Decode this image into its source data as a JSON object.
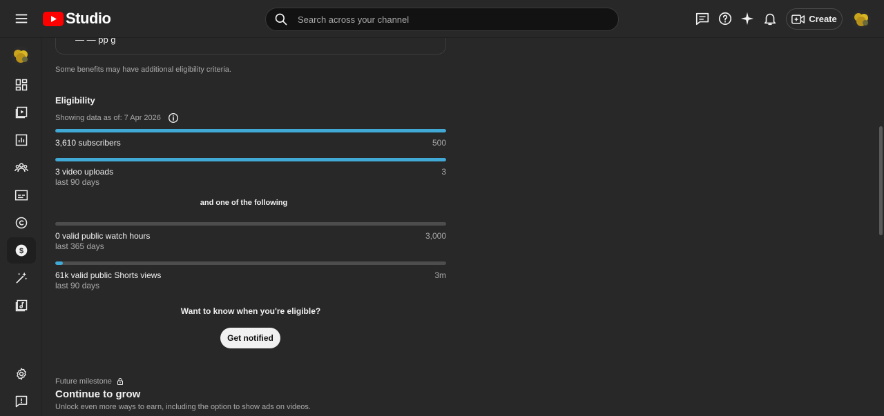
{
  "header": {
    "logo_text": "Studio",
    "search_placeholder": "Search across your channel",
    "create_label": "Create"
  },
  "sidebar": {
    "items": [
      {
        "name": "dashboard-icon"
      },
      {
        "name": "content-icon"
      },
      {
        "name": "analytics-icon"
      },
      {
        "name": "community-icon"
      },
      {
        "name": "subtitles-icon"
      },
      {
        "name": "copyright-icon"
      },
      {
        "name": "earn-icon",
        "active": true
      },
      {
        "name": "customization-icon"
      },
      {
        "name": "audio-library-icon"
      },
      {
        "name": "settings-icon"
      },
      {
        "name": "feedback-icon"
      }
    ]
  },
  "main": {
    "benefits_note": "Some benefits may have additional eligibility criteria.",
    "eligibility_title": "Eligibility",
    "data_as_of": "Showing data as of: 7 Apr 2026",
    "requirements": [
      {
        "label": "3,610 subscribers",
        "sublabel": "",
        "target": "500",
        "progress": 1.0
      },
      {
        "label": "3 video uploads",
        "sublabel": "last 90 days",
        "target": "3",
        "progress": 1.0
      }
    ],
    "and_one_of": "and one of the following",
    "alternatives": [
      {
        "label": "0 valid public watch hours",
        "sublabel": "last 365 days",
        "target": "3,000",
        "progress": 0.0
      },
      {
        "label": "61k valid public Shorts views",
        "sublabel": "last 90 days",
        "target": "3m",
        "progress": 0.02
      }
    ],
    "notify_prompt": "Want to know when you're eligible?",
    "notify_button": "Get notified",
    "future_label": "Future milestone",
    "future_title": "Continue to grow",
    "future_desc": "Unlock even more ways to earn, including the option to show ads on videos."
  },
  "colors": {
    "accent": "#41a9d6",
    "brand_red": "#ff0000",
    "background": "#282828"
  }
}
